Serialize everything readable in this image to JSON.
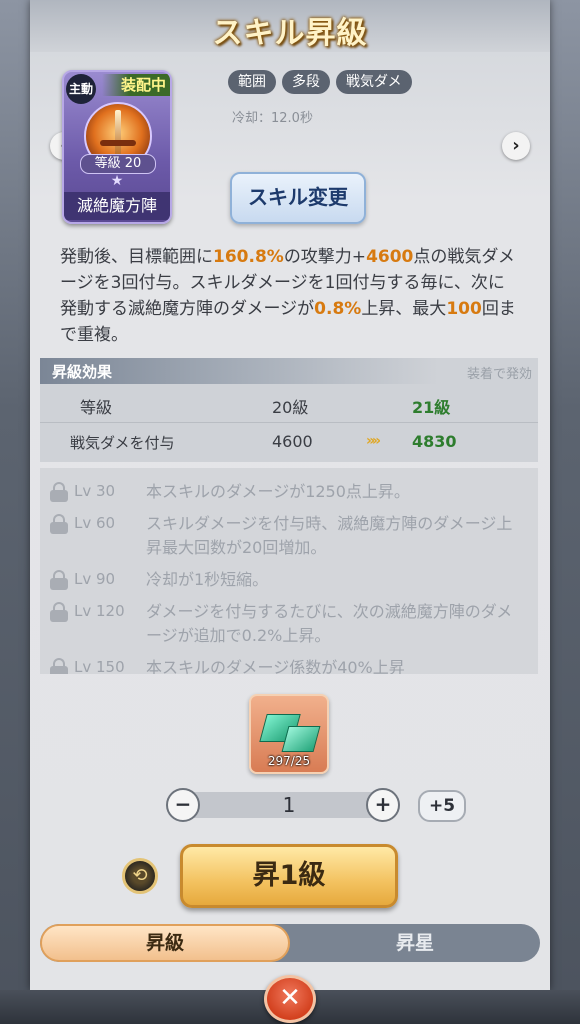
{
  "header": {
    "title": "スキル昇級"
  },
  "skill_card": {
    "type_tag": "主動",
    "equip_status": "装配中",
    "level": "等級 20",
    "name": "滅絶魔方陣"
  },
  "nav": {
    "prev": "‹",
    "next": "›"
  },
  "skill_tags": [
    "範囲",
    "多段",
    "戦気ダメ"
  ],
  "cooldown": "冷却：12.0秒",
  "change_button": "スキル変更",
  "description": {
    "p1": "発動後、目標範囲に",
    "v1": "160.8%",
    "p2": "の攻撃力+",
    "v2": "4600",
    "p3": "点の戦気ダメージを3回付与。スキルダメージを1回付与する毎に、次に発動する滅絶魔方陣のダメージが",
    "v3": "0.8%",
    "p4": "上昇、最大",
    "v4": "100",
    "p5": "回まで重複。"
  },
  "upgrade_effect": {
    "title": "昇級効果",
    "note": "装着で発効",
    "rows": [
      {
        "label": "等級",
        "current": "20級",
        "next": "21級"
      },
      {
        "label": "戦気ダメを付与",
        "current": "4600",
        "next": "4830"
      }
    ]
  },
  "level_unlocks": [
    {
      "level": "Lv 30",
      "text": "本スキルのダメージが1250点上昇。"
    },
    {
      "level": "Lv 60",
      "text": "スキルダメージを付与時、滅絶魔方陣のダメージ上昇最大回数が20回増加。"
    },
    {
      "level": "Lv 90",
      "text": "冷却が1秒短縮。"
    },
    {
      "level": "Lv 120",
      "text": "ダメージを付与するたびに、次の滅絶魔方陣のダメージが追加で0.2%上昇。"
    },
    {
      "level": "Lv 150",
      "text": "本スキルのダメージ係数が40%上昇"
    }
  ],
  "material": {
    "icon": "green-gem-icon",
    "count": "297/25"
  },
  "quantity": {
    "minus": "−",
    "value": "1",
    "plus": "+",
    "plus5": "+5"
  },
  "upgrade_button": "昇1級",
  "tabs": {
    "upgrade": "昇級",
    "star": "昇星"
  },
  "close_button": "✕"
}
